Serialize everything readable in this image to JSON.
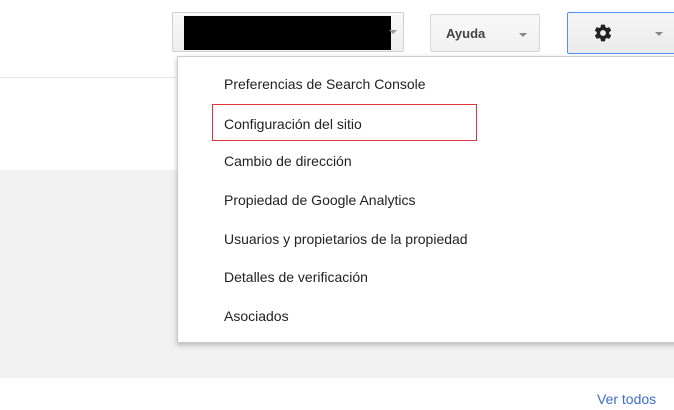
{
  "header": {
    "help_label": "Ayuda",
    "settings_icon": "gear-icon"
  },
  "settings_menu": {
    "items": [
      {
        "label": "Preferencias de Search Console"
      },
      {
        "label": "Configuración del sitio",
        "highlighted": true
      },
      {
        "label": "Cambio de dirección"
      },
      {
        "label": "Propiedad de Google Analytics"
      },
      {
        "label": "Usuarios y propietarios de la propiedad"
      },
      {
        "label": "Detalles de verificación"
      },
      {
        "label": "Asociados"
      }
    ]
  },
  "footer": {
    "see_all_label": "Ver todos"
  },
  "colors": {
    "highlight": "#e2333a",
    "link": "#3b6fc9",
    "active_border": "#4d90fe"
  }
}
